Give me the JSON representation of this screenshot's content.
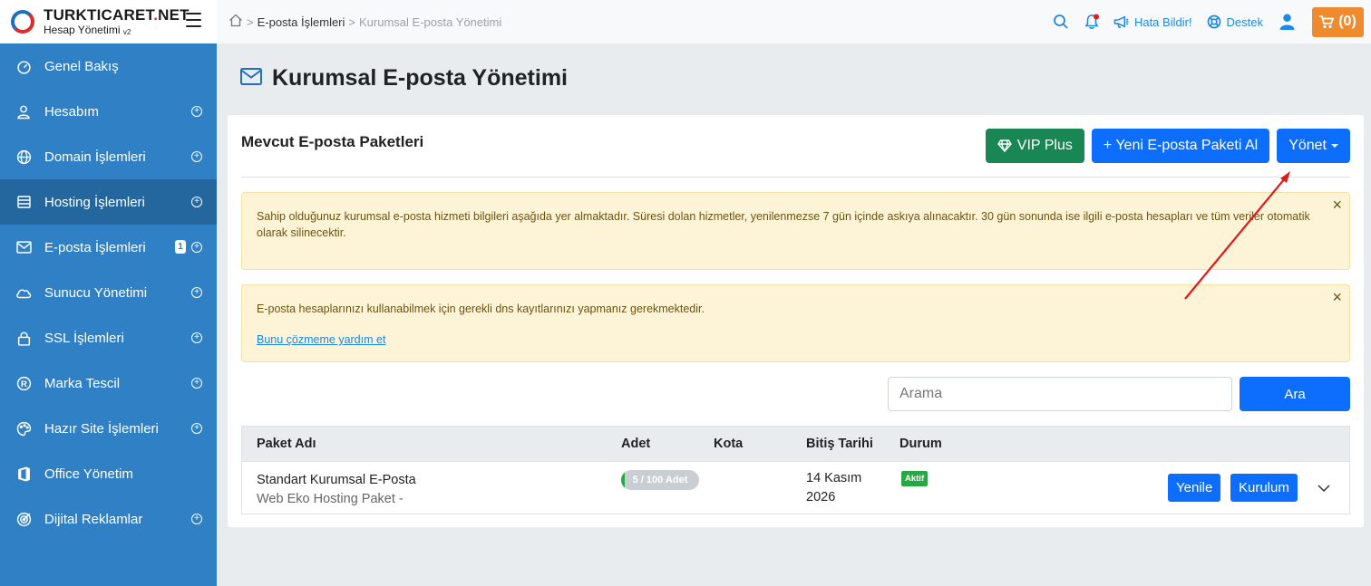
{
  "brand": {
    "name": "TURKTICARET",
    "name_dot": ".",
    "name_tld": "NET",
    "subtitle": "Hesap Yönetimi",
    "version": "v2"
  },
  "sidebar": {
    "items": [
      {
        "label": "Genel Bakış",
        "icon": "dashboard-icon"
      },
      {
        "label": "Hesabım",
        "icon": "user-icon"
      },
      {
        "label": "Domain İşlemleri",
        "icon": "globe-icon"
      },
      {
        "label": "Hosting İşlemleri",
        "icon": "server-icon"
      },
      {
        "label": "E-posta İşlemleri",
        "icon": "envelope-icon",
        "badge": "1"
      },
      {
        "label": "Sunucu Yönetimi",
        "icon": "cloud-icon"
      },
      {
        "label": "SSL İşlemleri",
        "icon": "lock-icon"
      },
      {
        "label": "Marka Tescil",
        "icon": "registered-icon"
      },
      {
        "label": "Hazır Site İşlemleri",
        "icon": "palette-icon"
      },
      {
        "label": "Office Yönetim",
        "icon": "office-icon"
      },
      {
        "label": "Dijital Reklamlar",
        "icon": "target-icon"
      }
    ]
  },
  "topbar": {
    "breadcrumb": {
      "parent": "E-posta İşlemleri",
      "current": "Kurumsal E-posta Yönetimi",
      "separator": ">"
    },
    "report_bug": "Hata Bildir!",
    "support": "Destek",
    "cart": "(0)"
  },
  "page": {
    "title": "Kurumsal E-posta Yönetimi"
  },
  "card": {
    "title": "Mevcut E-posta Paketleri",
    "vip_button": "VIP Plus",
    "new_package_button": "+ Yeni E-posta Paketi Al",
    "manage_button": "Yönet",
    "alert1": "Sahip olduğunuz kurumsal e-posta hizmeti bilgileri aşağıda yer almaktadır. Süresi dolan hizmetler, yenilenmezse 7 gün içinde askıya alınacaktır. 30 gün sonunda ise ilgili e-posta hesapları ve tüm veriler otomatik olarak silinecektir.",
    "alert2": "E-posta hesaplarınızı kullanabilmek için gerekli dns kayıtlarınızı yapmanız gerekmektedir.",
    "alert2_link": "Bunu çözmeme yardım et",
    "close_symbol": "×",
    "search_placeholder": "Arama",
    "search_button": "Ara"
  },
  "table": {
    "headers": {
      "name": "Paket Adı",
      "count": "Adet",
      "quota": "Kota",
      "end_date": "Bitiş Tarihi",
      "status": "Durum"
    },
    "rows": [
      {
        "name": "Standart Kurumsal E-Posta",
        "subname": "Web Eko Hosting Paket -",
        "usage": "5 / 100 Adet",
        "usage_fraction": 0.05,
        "quota": "",
        "date_line1": "14 Kasım",
        "date_line2": "2026",
        "status": "Aktif",
        "renew": "Yenile",
        "setup": "Kurulum"
      }
    ]
  },
  "colors": {
    "sidebar": "#2f80c4",
    "primary": "#0d6efd",
    "success": "#198754",
    "cart": "#ef8a2e",
    "alert_bg": "#fdf3d6",
    "annotation": "#e01b1b"
  }
}
